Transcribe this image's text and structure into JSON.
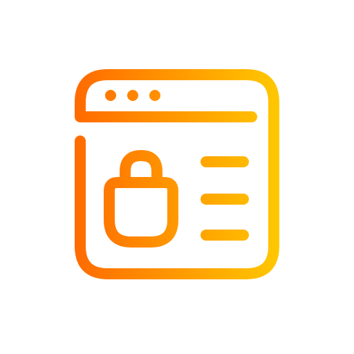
{
  "icon": {
    "name": "online-shop-browser-icon",
    "gradient_start": "#FF6A00",
    "gradient_end": "#FFC800",
    "parts": {
      "window": "browser-window-icon",
      "dots": "window-dots-icon",
      "bag": "shopping-bag-icon",
      "lines": "text-lines-icon"
    }
  }
}
